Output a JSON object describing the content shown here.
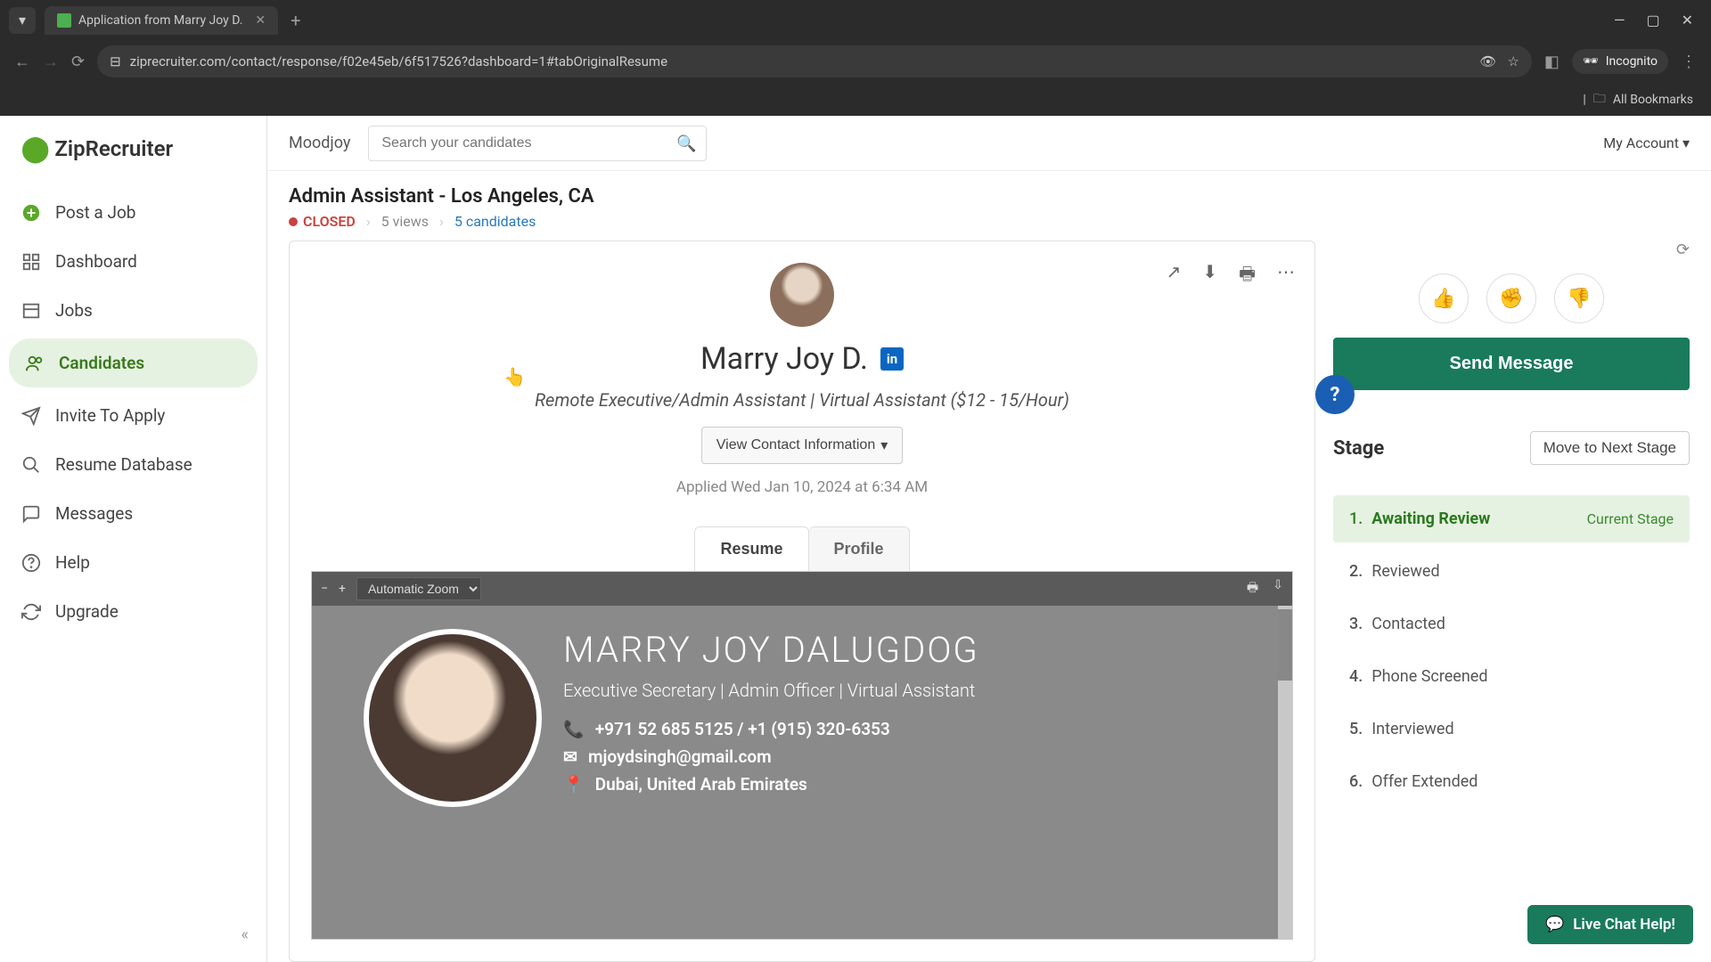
{
  "browser": {
    "tab_title": "Application from Marry Joy D.",
    "url": "ziprecruiter.com/contact/response/f02e45eb/6f517526?dashboard=1#tabOriginalResume",
    "incognito": "Incognito",
    "bookmarks": "All Bookmarks"
  },
  "sidebar": {
    "logo": "ZipRecruiter",
    "items": [
      {
        "label": "Post a Job"
      },
      {
        "label": "Dashboard"
      },
      {
        "label": "Jobs"
      },
      {
        "label": "Candidates"
      },
      {
        "label": "Invite To Apply"
      },
      {
        "label": "Resume Database"
      },
      {
        "label": "Messages"
      },
      {
        "label": "Help"
      },
      {
        "label": "Upgrade"
      }
    ]
  },
  "topbar": {
    "org": "Moodjoy",
    "search_placeholder": "Search your candidates",
    "account": "My Account"
  },
  "job": {
    "title": "Admin Assistant - Los Angeles, CA",
    "status": "CLOSED",
    "views": "5 views",
    "candidates": "5 candidates"
  },
  "candidate": {
    "name": "Marry Joy D.",
    "headline": "Remote Executive/Admin Assistant | Virtual Assistant ($12 - 15/Hour)",
    "view_contact": "View Contact Information",
    "applied": "Applied Wed Jan 10, 2024 at 6:34 AM",
    "tabs": {
      "resume": "Resume",
      "profile": "Profile"
    }
  },
  "pdf": {
    "zoom": "Automatic Zoom",
    "resume_name": "MARRY JOY DALUGDOG",
    "resume_role": "Executive Secretary  |  Admin Officer  |  Virtual Assistant",
    "phone": "+971 52 685 5125 / +1 (915) 320-6353",
    "email": "mjoydsingh@gmail.com",
    "location": "Dubai, United Arab Emirates"
  },
  "actions": {
    "send_message": "Send Message"
  },
  "stage": {
    "title": "Stage",
    "move": "Move to Next Stage",
    "current_label": "Current Stage",
    "items": [
      {
        "num": "1.",
        "label": "Awaiting Review"
      },
      {
        "num": "2.",
        "label": "Reviewed"
      },
      {
        "num": "3.",
        "label": "Contacted"
      },
      {
        "num": "4.",
        "label": "Phone Screened"
      },
      {
        "num": "5.",
        "label": "Interviewed"
      },
      {
        "num": "6.",
        "label": "Offer Extended"
      }
    ]
  },
  "chat": {
    "label": "Live Chat Help!"
  }
}
